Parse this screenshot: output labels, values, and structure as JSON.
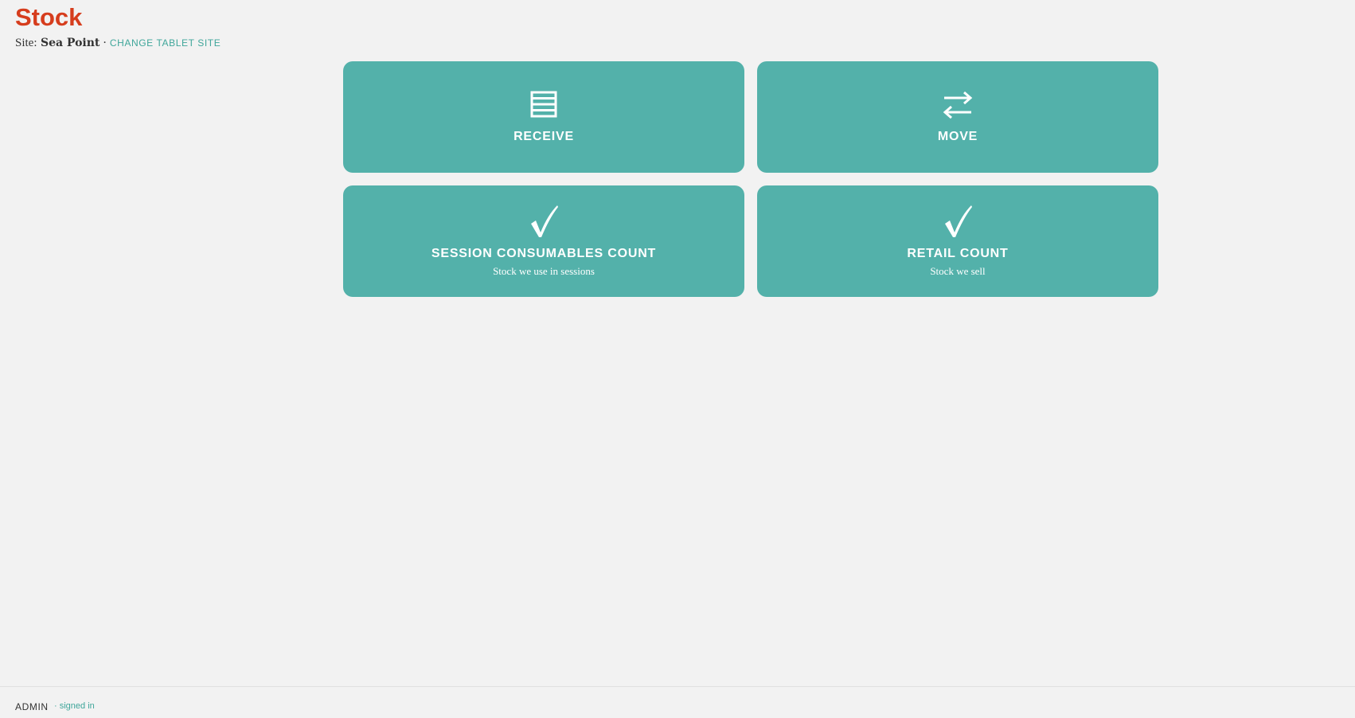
{
  "header": {
    "title": "Stock",
    "site_label": "Site:",
    "site_name": "Sea Point",
    "separator": "·",
    "change_site_link": "CHANGE TABLET SITE"
  },
  "tiles": [
    {
      "label": "RECEIVE",
      "subtitle": "",
      "icon": "list-icon"
    },
    {
      "label": "MOVE",
      "subtitle": "",
      "icon": "transfer-arrows-icon"
    },
    {
      "label": "SESSION CONSUMABLES COUNT",
      "subtitle": "Stock we use in sessions",
      "icon": "checkmark-icon"
    },
    {
      "label": "RETAIL COUNT",
      "subtitle": "Stock we sell",
      "icon": "checkmark-icon"
    }
  ],
  "footer": {
    "user": "ADMIN",
    "status": "· signed in"
  },
  "colors": {
    "title": "#d63d1d",
    "tile_background": "#53b1aa",
    "link": "#3fa69a",
    "page_background": "#f2f2f2"
  }
}
